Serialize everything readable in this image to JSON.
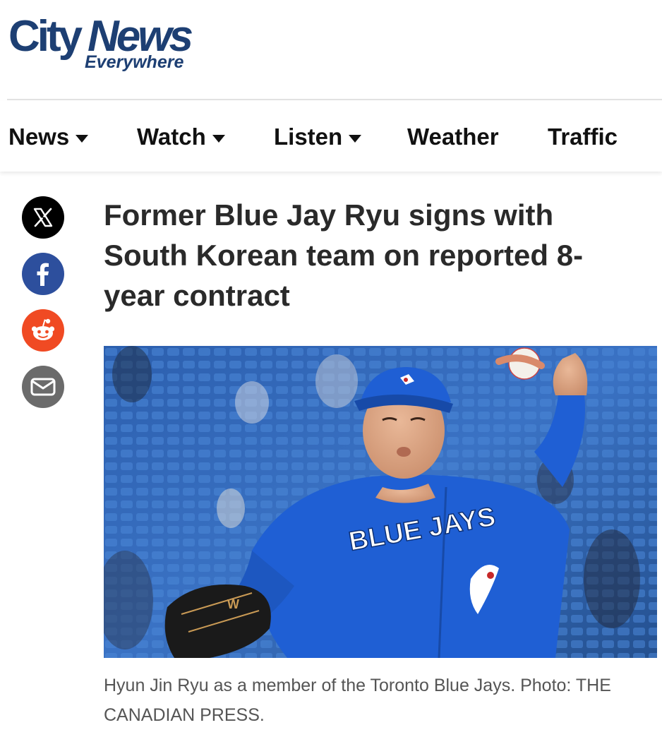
{
  "brand": {
    "name": "CityNews",
    "name_part1": "City",
    "name_part2": "News",
    "tagline": "Everywhere",
    "color": "#1d3f73"
  },
  "nav": {
    "items": [
      {
        "label": "News",
        "has_dropdown": true
      },
      {
        "label": "Watch",
        "has_dropdown": true
      },
      {
        "label": "Listen",
        "has_dropdown": true
      },
      {
        "label": "Weather",
        "has_dropdown": false
      },
      {
        "label": "Traffic",
        "has_dropdown": false
      }
    ]
  },
  "share": {
    "buttons": [
      {
        "name": "x",
        "icon": "x-logo-icon",
        "color": "#000000"
      },
      {
        "name": "facebook",
        "icon": "facebook-icon",
        "color": "#2d4f9d"
      },
      {
        "name": "reddit",
        "icon": "reddit-icon",
        "color": "#f04a23"
      },
      {
        "name": "email",
        "icon": "envelope-icon",
        "color": "#6b6b6b"
      }
    ]
  },
  "article": {
    "headline": "Former Blue Jay Ryu signs with South Korean team on reported 8-year contract",
    "photo": {
      "description_icon": "pitcher-photo",
      "jersey_text": "BLUE JAYS",
      "glove_text": "W"
    },
    "caption": "Hyun Jin Ryu as a member of the Toronto Blue Jays. Photo: THE CANADIAN PRESS."
  }
}
